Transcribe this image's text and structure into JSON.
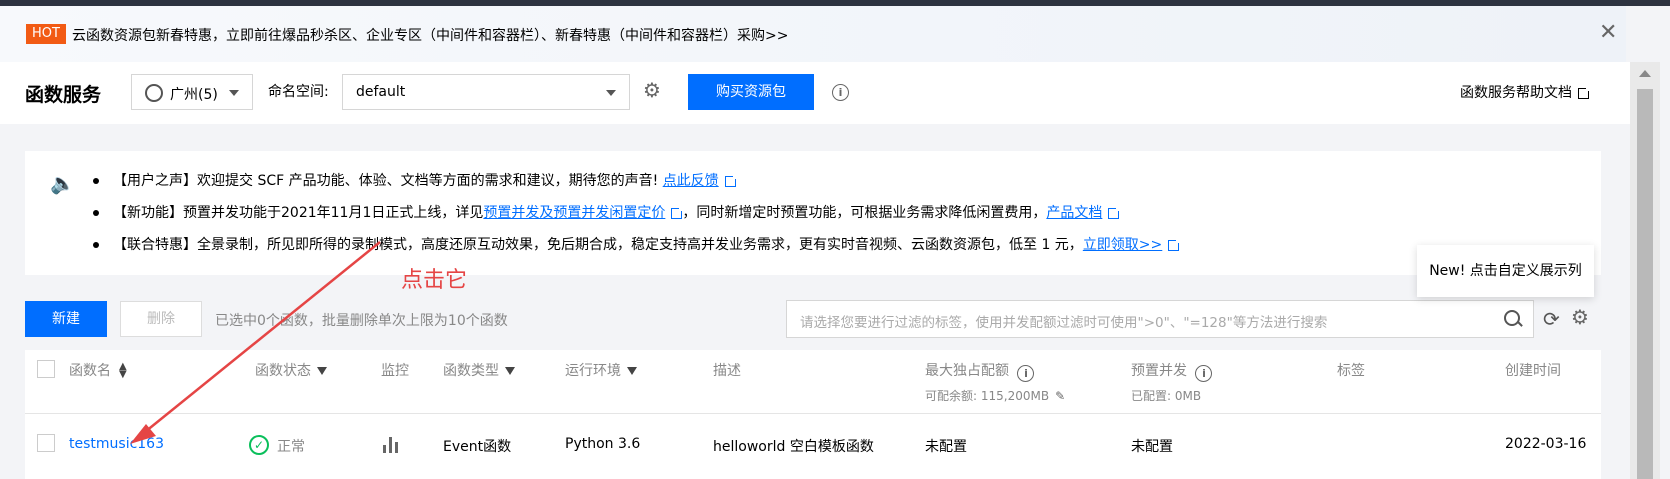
{
  "banner": {
    "hot_tag": "HOT",
    "text": "云函数资源包新春特惠，立即前往爆品秒杀区、企业专区（中间件和容器栏）、新春特惠（中间件和容器栏）采购>>",
    "close_icon": "close-icon"
  },
  "header": {
    "title": "函数服务",
    "region": "广州(5)",
    "namespace_label": "命名空间:",
    "namespace_value": "default",
    "buy_button": "购买资源包",
    "help_link": "函数服务帮助文档"
  },
  "notice": {
    "items": [
      {
        "text": "【用户之声】欢迎提交 SCF 产品功能、体验、文档等方面的需求和建议，期待您的声音!",
        "link1": "点此反馈",
        "text2": "",
        "link2": ""
      },
      {
        "text": "【新功能】预置并发功能于2021年11月1日正式上线，详见",
        "link1": "预置并发及预置并发闲置定价",
        "text2": "，同时新增定时预置功能，可根据业务需求降低闲置费用，",
        "link2": "产品文档"
      },
      {
        "text": "【联合特惠】全景录制，所见即所得的录制模式，高度还原互动效果，免后期合成，稳定支持高并发业务需求，更有实时音视频、云函数资源包，低至 1 元，",
        "link1": "立即领取>>",
        "text2": "",
        "link2": ""
      }
    ]
  },
  "annotation": "点击它",
  "toolbar": {
    "new_button": "新建",
    "delete_button": "删除",
    "selection_info": "已选中0个函数，批量删除单次上限为10个函数",
    "search_placeholder": "请选择您要进行过滤的标签，使用并发配额过滤时可使用\">0\"、\"=128\"等方法进行搜索",
    "tooltip": "New! 点击自定义展示列"
  },
  "table": {
    "headers": {
      "name": "函数名",
      "status": "函数状态",
      "monitor": "监控",
      "type": "函数类型",
      "runtime": "运行环境",
      "desc": "描述",
      "max_quota": "最大独占配额",
      "max_quota_sub": "可配余额: 115,200MB",
      "provisioned": "预置并发",
      "provisioned_sub": "已配置: 0MB",
      "tags": "标签",
      "created": "创建时间"
    },
    "rows": [
      {
        "name": "testmusic163",
        "status": "正常",
        "type": "Event函数",
        "runtime": "Python 3.6",
        "desc": "helloworld 空白模板函数",
        "max_quota": "未配置",
        "provisioned": "未配置",
        "created": "2022-03-16"
      }
    ]
  },
  "colors": {
    "primary": "#006eff",
    "hot": "#f25b14",
    "annotation": "#e54545",
    "ok": "#0abf5b"
  }
}
